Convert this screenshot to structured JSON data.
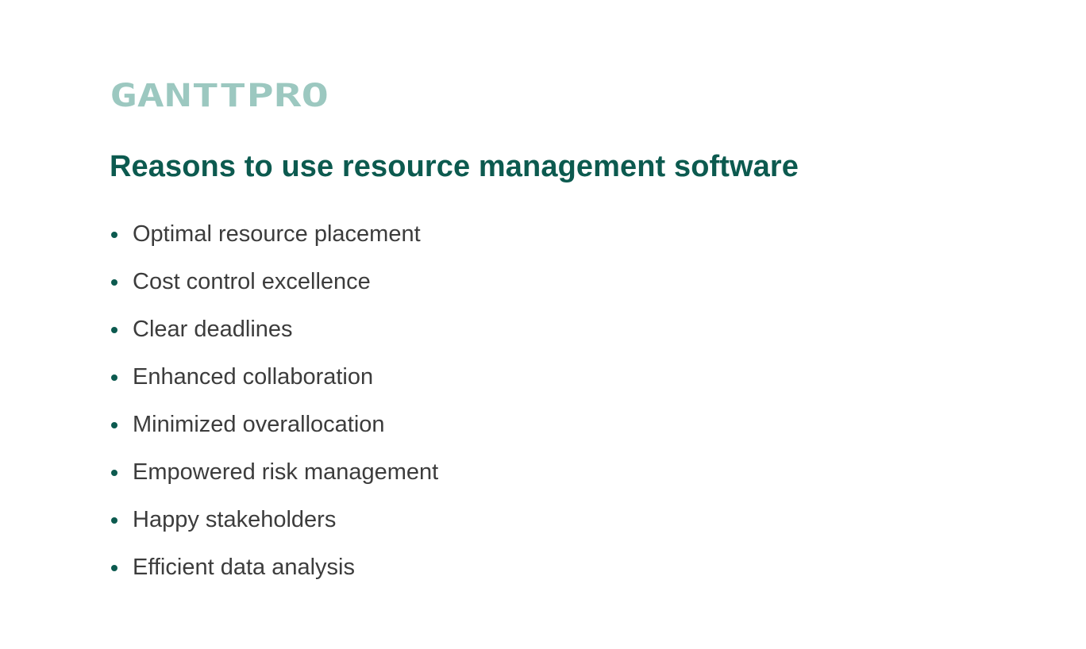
{
  "brand": {
    "logo_text": "GANTTPRO",
    "logo_color": "#9cc8c0"
  },
  "heading": {
    "title": "Reasons to use resource management software",
    "color": "#0c5a4f"
  },
  "list": {
    "text_color": "#3c3c3c",
    "bullet_color": "#0c5a4f",
    "items": [
      "Optimal resource placement",
      "Cost control excellence",
      "Clear deadlines",
      "Enhanced collaboration",
      "Minimized overallocation",
      "Empowered risk management",
      "Happy stakeholders",
      "Efficient data analysis"
    ]
  }
}
